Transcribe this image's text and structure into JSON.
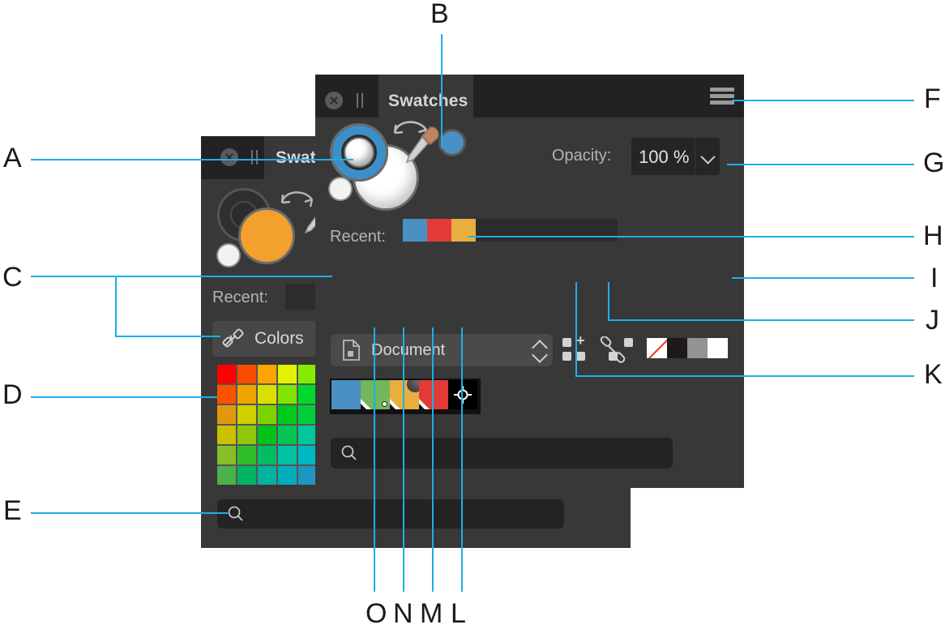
{
  "figure": {
    "accent_color": "#1ab0e8",
    "background": "#ffffff",
    "callouts": [
      {
        "id": "A",
        "letter": "A",
        "target": "fill-stroke-color-indicator"
      },
      {
        "id": "B",
        "letter": "B",
        "target": "current-color-eyedropper"
      },
      {
        "id": "C",
        "letter": "C",
        "target": "swatch-libraries-selector"
      },
      {
        "id": "D",
        "letter": "D",
        "target": "color-grid"
      },
      {
        "id": "E",
        "letter": "E",
        "target": "search-field"
      },
      {
        "id": "F",
        "letter": "F",
        "target": "panel-menu-button"
      },
      {
        "id": "G",
        "letter": "G",
        "target": "opacity-field"
      },
      {
        "id": "H",
        "letter": "H",
        "target": "recent-colors-well"
      },
      {
        "id": "I",
        "letter": "I",
        "target": "color-mode-chips"
      },
      {
        "id": "J",
        "letter": "J",
        "target": "link-swatch-button"
      },
      {
        "id": "K",
        "letter": "K",
        "target": "new-swatch-group-button"
      },
      {
        "id": "L",
        "letter": "L",
        "target": "registration-swatch"
      },
      {
        "id": "M",
        "letter": "M",
        "target": "spot-color-swatch"
      },
      {
        "id": "N",
        "letter": "N",
        "target": "gradient-swatch"
      },
      {
        "id": "O",
        "letter": "O",
        "target": "global-color-swatch"
      }
    ]
  },
  "front_panel": {
    "tab": {
      "title": "Swatches",
      "close_icon": "close-icon",
      "pause_icon": "pause-icon",
      "menu_icon": "hamburger-menu-icon"
    },
    "color_indicator": {
      "fill_icon": "fill-color-ring",
      "stroke_icon": "stroke-color-circle",
      "swap_icon": "swap-fill-stroke-icon",
      "none_icon": "none-color-icon",
      "fill_color": "#ffffff",
      "stroke_color": "#3d8fc9",
      "none_slash_color": "#e0352b"
    },
    "eyedropper": {
      "icon": "eyedropper-icon",
      "current_color": "#4a90c2"
    },
    "opacity": {
      "label": "Opacity:",
      "value": "100 %",
      "dropdown_icon": "chevron-down-icon"
    },
    "recent": {
      "label": "Recent:",
      "chips": [
        "#4a90c2",
        "#e23b37",
        "#e8ae3e"
      ]
    },
    "library_selector": {
      "icon": "document-icon",
      "label": "Document",
      "spinner_icon": "spinner-updown-icon"
    },
    "group_buttons": {
      "new_group_icon": "new-swatch-group-icon",
      "link_icon": "link-swatch-icon"
    },
    "mode_chips": [
      {
        "name": "none-chip",
        "color": "none"
      },
      {
        "name": "black-chip",
        "color": "#1e1a1a"
      },
      {
        "name": "gray-chip",
        "color": "#939393"
      },
      {
        "name": "white-chip",
        "color": "#ffffff"
      }
    ],
    "swatch_strip": [
      {
        "name": "process-color-swatch",
        "color": "#4a90c2",
        "markers": []
      },
      {
        "name": "global-color-swatch",
        "color": "#72b75c",
        "markers": [
          "corner",
          "globe"
        ]
      },
      {
        "name": "gradient-swatch",
        "color": "#e8ae3e",
        "markers": [
          "corner",
          "gradient"
        ]
      },
      {
        "name": "spot-color-swatch",
        "color": "#e23b37",
        "markers": [
          "corner"
        ]
      },
      {
        "name": "registration-swatch",
        "color": "#000000",
        "markers": [
          "registration"
        ]
      }
    ],
    "search": {
      "icon": "search-icon",
      "value": "",
      "placeholder": ""
    }
  },
  "back_panel": {
    "tab": {
      "title": "Swatc",
      "close_icon": "close-icon",
      "pause_icon": "pause-icon"
    },
    "color_indicator": {
      "fill_color": "#f4a02c",
      "stroke_color": "#262626",
      "swap_icon": "swap-fill-stroke-icon",
      "none_icon": "none-color-icon"
    },
    "eyedropper": {
      "icon": "eyedropper-icon"
    },
    "recent": {
      "label": "Recent:"
    },
    "colors_button": {
      "icon": "link-swatch-icon",
      "label": "Colors"
    },
    "search": {
      "icon": "search-icon",
      "value": "",
      "placeholder": ""
    },
    "color_grid": {
      "columns": 5,
      "rows": 6,
      "colors": [
        "#fe0000",
        "#fa4c00",
        "#fda400",
        "#e2f200",
        "#84ec00",
        "#fa5200",
        "#eea500",
        "#d9e000",
        "#7ee400",
        "#00d929",
        "#e0990f",
        "#cfd000",
        "#7fd200",
        "#00cb1c",
        "#00cf38",
        "#cac000",
        "#8ec80a",
        "#00c21a",
        "#00c553",
        "#00c79a",
        "#86bf26",
        "#30bd2c",
        "#00bd64",
        "#00c2a0",
        "#00b8c4",
        "#4bb14b",
        "#00b464",
        "#00b2a0",
        "#00adbb",
        "#1f96c1"
      ]
    }
  }
}
